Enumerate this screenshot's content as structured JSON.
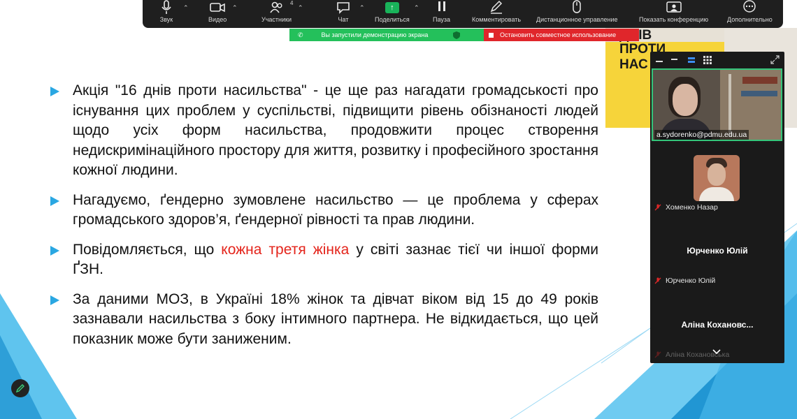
{
  "toolbar": {
    "items": [
      {
        "label": "Звук",
        "icon": "microphone-icon"
      },
      {
        "label": "Видео",
        "icon": "video-camera-icon"
      },
      {
        "label": "Участники",
        "icon": "participants-icon",
        "count": "4"
      },
      {
        "label": "Чат",
        "icon": "chat-icon"
      },
      {
        "label": "Поделиться",
        "icon": "share-screen-icon"
      },
      {
        "label": "Пауза",
        "icon": "pause-icon"
      },
      {
        "label": "Комментировать",
        "icon": "annotate-pen-icon"
      },
      {
        "label": "Дистанционное управление",
        "icon": "remote-control-mouse-icon"
      },
      {
        "label": "Показать конференцию",
        "icon": "show-meeting-icon"
      },
      {
        "label": "Дополнительно",
        "icon": "more-icon"
      }
    ]
  },
  "share_banner": {
    "status": "Вы запустили демонстрацию экрана",
    "stop": "Остановить совместное использование"
  },
  "poster": {
    "lines": [
      "ДНІВ",
      "ПРОТИ",
      "НАС"
    ]
  },
  "slide": {
    "bullets": [
      {
        "text": "Акція \"16 днів проти насильства\" - це ще раз нагадати громадськості про існування цих проблем у суспільстві, підвищити рівень обізнаності людей щодо усіх форм насильства, продовжити процес створення недискримінаційного простору для життя, розвитку і професійного зростання кожної людини."
      },
      {
        "text": "Нагадуємо, ґендерно зумовлене насильство — це проблема у сферах громадського здоров’я, ґендерної рівності та прав людини."
      },
      {
        "before": "Повідомляється, що ",
        "highlight": "кожна третя жінка",
        "after": " у світі зазнає тієї чи іншої форми ҐЗН."
      },
      {
        "text": "За даними МОЗ, в Україні 18% жінок та дівчат віком від 15 до 49 років зазнавали насильства з боку інтимного партнера. Не відкидається, що цей показник може бути заниженим."
      }
    ]
  },
  "participants": {
    "active_speaker": "a.sydorenko@pdmu.edu.ua",
    "list": [
      {
        "display": "",
        "name": "Хоменко Назар",
        "muted": true
      },
      {
        "display": "Юрченко Юлій",
        "name": "Юрченко Юлій",
        "muted": true
      },
      {
        "display": "Аліна  Кохановс...",
        "name": "Аліна Кохановська",
        "muted": true
      }
    ]
  },
  "colors": {
    "accent_blue": "#2aa7e2",
    "highlight_red": "#e4241b",
    "banner_green": "#24c05b",
    "banner_red": "#e0262b",
    "active_border": "#34c57a"
  }
}
